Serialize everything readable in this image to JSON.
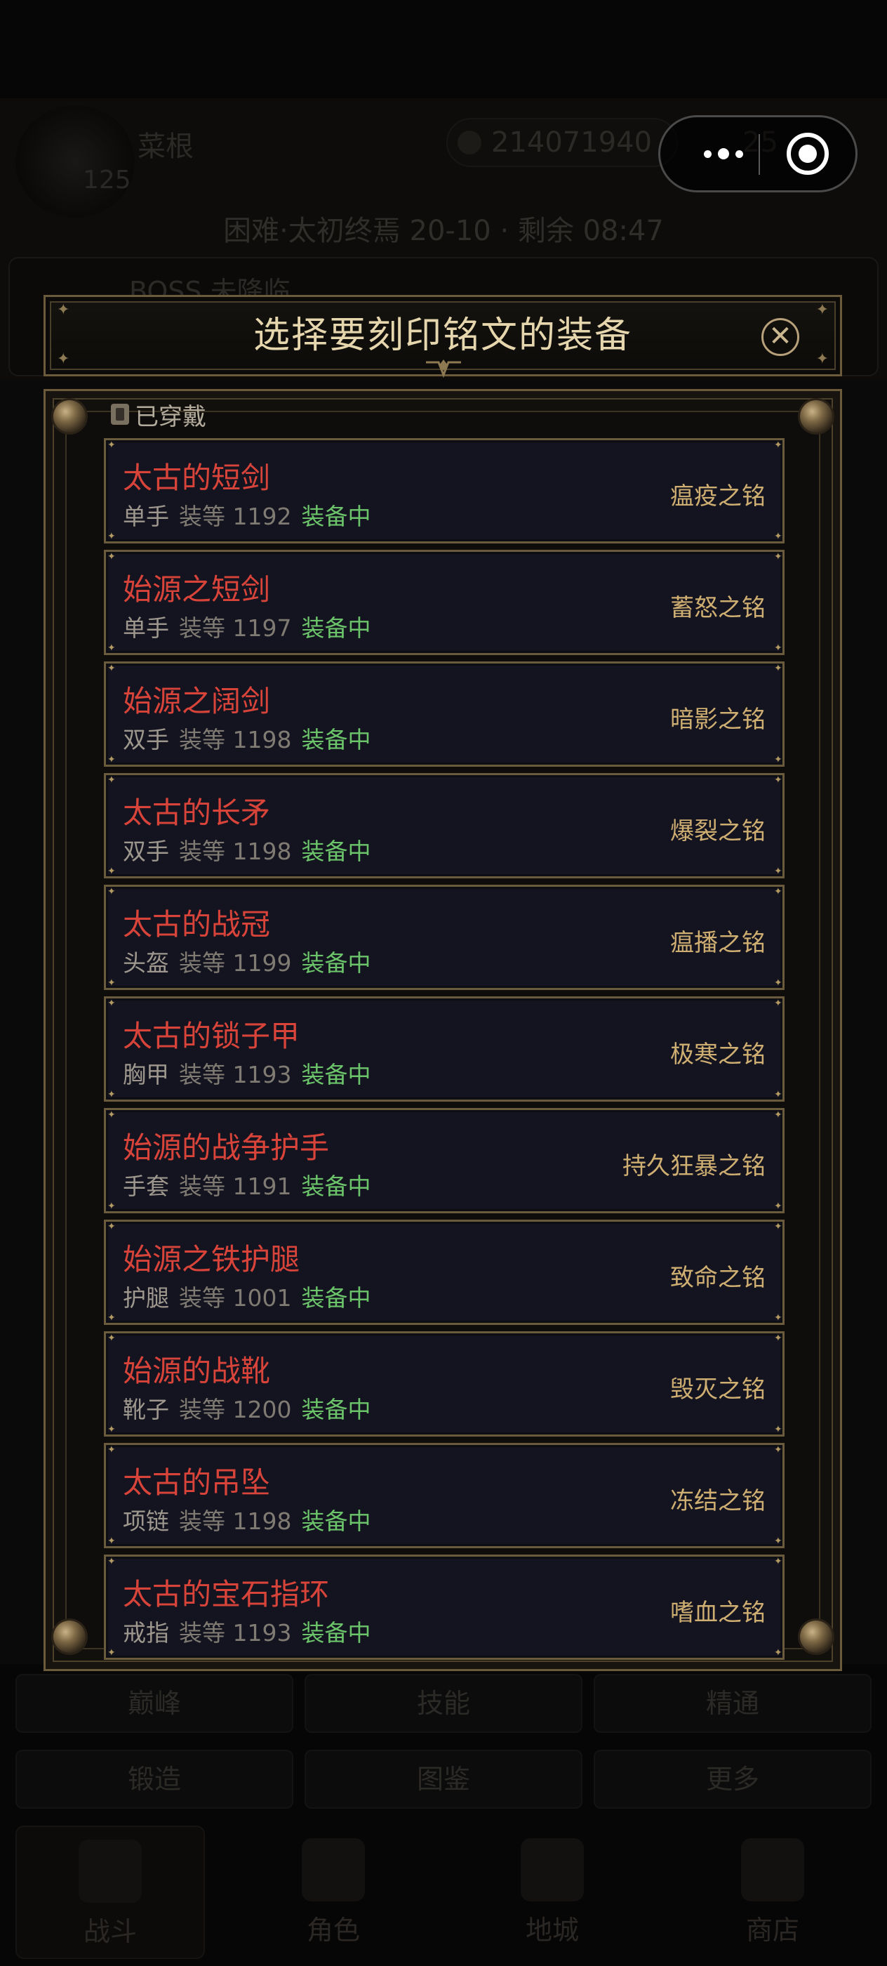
{
  "background": {
    "player_name": "菜根",
    "player_level": "125",
    "gold": "214071940",
    "diamond": "25",
    "stage": "困难·太初终焉 20-10 · 剩余 08:47",
    "boss": "BOSS 未降临",
    "menu_row1": [
      "巅峰",
      "技能",
      "精通"
    ],
    "menu_row2": [
      "锻造",
      "图鉴",
      "更多"
    ],
    "tabs": [
      "战斗",
      "角色",
      "地城",
      "商店"
    ]
  },
  "modal": {
    "title": "选择要刻印铭文的装备",
    "close_icon": "close-icon",
    "section_label": "已穿戴",
    "items": [
      {
        "name": "太古的短剑",
        "slot": "单手",
        "ilvl": "装等 1192",
        "status": "装备中",
        "rune": "瘟疫之铭"
      },
      {
        "name": "始源之短剑",
        "slot": "单手",
        "ilvl": "装等 1197",
        "status": "装备中",
        "rune": "蓄怒之铭"
      },
      {
        "name": "始源之阔剑",
        "slot": "双手",
        "ilvl": "装等 1198",
        "status": "装备中",
        "rune": "暗影之铭"
      },
      {
        "name": "太古的长矛",
        "slot": "双手",
        "ilvl": "装等 1198",
        "status": "装备中",
        "rune": "爆裂之铭"
      },
      {
        "name": "太古的战冠",
        "slot": "头盔",
        "ilvl": "装等 1199",
        "status": "装备中",
        "rune": "瘟播之铭"
      },
      {
        "name": "太古的锁子甲",
        "slot": "胸甲",
        "ilvl": "装等 1193",
        "status": "装备中",
        "rune": "极寒之铭"
      },
      {
        "name": "始源的战争护手",
        "slot": "手套",
        "ilvl": "装等 1191",
        "status": "装备中",
        "rune": "持久狂暴之铭"
      },
      {
        "name": "始源之铁护腿",
        "slot": "护腿",
        "ilvl": "装等 1001",
        "status": "装备中",
        "rune": "致命之铭"
      },
      {
        "name": "始源的战靴",
        "slot": "靴子",
        "ilvl": "装等 1200",
        "status": "装备中",
        "rune": "毁灭之铭"
      },
      {
        "name": "太古的吊坠",
        "slot": "项链",
        "ilvl": "装等 1198",
        "status": "装备中",
        "rune": "冻结之铭"
      },
      {
        "name": "太古的宝石指环",
        "slot": "戒指",
        "ilvl": "装等 1193",
        "status": "装备中",
        "rune": "嗜血之铭"
      }
    ]
  },
  "colors": {
    "item_name": "#d8443a",
    "equipped": "#6cc46a",
    "rune": "#cfae72",
    "frame_gold": "#6b5b3a",
    "title_text": "#e6d6ae"
  }
}
